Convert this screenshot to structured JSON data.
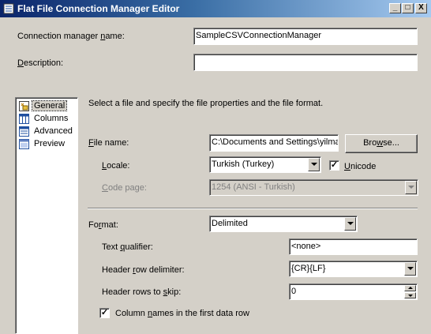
{
  "window": {
    "title": "Flat File Connection Manager Editor",
    "min_symbol": "_",
    "max_symbol": "□",
    "close_symbol": "X"
  },
  "connection": {
    "name_label_pre": "Connection manager ",
    "name_label_key": "n",
    "name_label_post": "ame:",
    "name_value": "SampleCSVConnectionManager",
    "desc_label_pre": "",
    "desc_label_key": "D",
    "desc_label_post": "escription:",
    "desc_value": ""
  },
  "nav": {
    "items": [
      {
        "label": "General",
        "icon": "general-icon",
        "selected": true
      },
      {
        "label": "Columns",
        "icon": "columns-icon",
        "selected": false
      },
      {
        "label": "Advanced",
        "icon": "advanced-icon",
        "selected": false
      },
      {
        "label": "Preview",
        "icon": "preview-icon",
        "selected": false
      }
    ]
  },
  "general": {
    "instructions": "Select a file and specify the file properties and the file format.",
    "file_name_label_pre": "",
    "file_name_label_key": "F",
    "file_name_label_post": "ile name:",
    "file_name_value": "C:\\Documents and Settings\\yilma",
    "browse_label_pre": "Bro",
    "browse_label_key": "w",
    "browse_label_post": "se...",
    "locale_label_pre": "",
    "locale_label_key": "L",
    "locale_label_post": "ocale:",
    "locale_value": "Turkish (Turkey)",
    "unicode_label_pre": "",
    "unicode_label_key": "U",
    "unicode_label_post": "nicode",
    "unicode_checked": true,
    "codepage_label_pre": "",
    "codepage_label_key": "C",
    "codepage_label_post": "ode page:",
    "codepage_value": "1254  (ANSI - Turkish)",
    "format_label_pre": "Fo",
    "format_label_key": "r",
    "format_label_post": "mat:",
    "format_value": "Delimited",
    "text_qualifier_label_pre": "Text ",
    "text_qualifier_label_key": "q",
    "text_qualifier_label_post": "ualifier:",
    "text_qualifier_value": "<none>",
    "header_delim_label_pre": "Header ",
    "header_delim_label_key": "r",
    "header_delim_label_post": "ow delimiter:",
    "header_delim_value": "{CR}{LF}",
    "header_skip_label_pre": "Header rows to ",
    "header_skip_label_key": "s",
    "header_skip_label_post": "kip:",
    "header_skip_value": "0",
    "col_names_label_pre": "Column ",
    "col_names_label_key": "n",
    "col_names_label_post": "ames in the first data row",
    "col_names_checked": true
  }
}
